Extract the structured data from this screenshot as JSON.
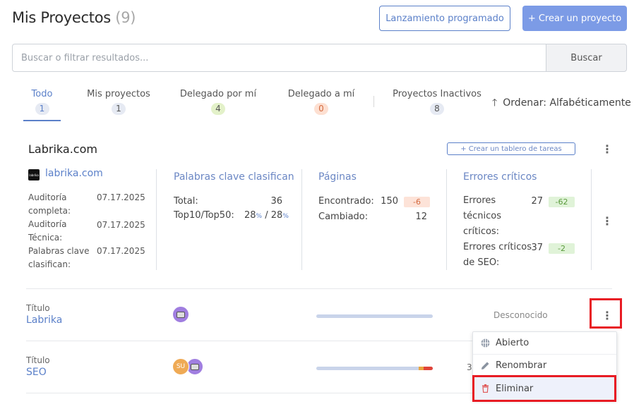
{
  "header": {
    "title": "Mis Proyectos",
    "count": "(9)",
    "scheduled_button": "Lanzamiento programado",
    "create_button": "+ Crear un proyecto"
  },
  "search": {
    "placeholder": "Buscar o filtrar resultados...",
    "button": "Buscar"
  },
  "tabs": [
    {
      "label": "Todo",
      "count": "1",
      "badge_color": "#e6eaf3"
    },
    {
      "label": "Mis proyectos",
      "count": "1",
      "badge_color": "#e6eaf3"
    },
    {
      "label": "Delegado por mí",
      "count": "4",
      "badge_color": "#e3f1c9"
    },
    {
      "label": "Delegado a mí",
      "count": "0",
      "badge_color": "#fde0d2"
    },
    {
      "label": "Proyectos Inactivos",
      "count": "8",
      "badge_color": "#e6eaf3"
    }
  ],
  "sort": {
    "label": "Ordenar: Alfabéticamente",
    "icon": "arrow-up-icon"
  },
  "project": {
    "name": "Labrika.com",
    "create_board": "+ Crear un tablero de tareas",
    "site": "labrika.com",
    "logo_text": "labrika",
    "audits": [
      {
        "label": "Auditoría completa:",
        "date": "07.17.2025"
      },
      {
        "label": "Auditoría Técnica:",
        "date": "07.17.2025"
      },
      {
        "label": "Palabras clave clasifican:",
        "date": "07.17.2025"
      }
    ],
    "keywords": {
      "title": "Palabras clave clasifican",
      "total_label": "Total:",
      "total_value": "36",
      "top_label": "Top10/Top50:",
      "top10": "28",
      "top50": "28",
      "pct": "%",
      "slash": " / "
    },
    "pages": {
      "title": "Páginas",
      "found_label": "Encontrado:",
      "found_value": "150",
      "found_delta": "-6",
      "changed_label": "Cambiado:",
      "changed_value": "12"
    },
    "errors": {
      "title": "Errores críticos",
      "tech_label": "Errores técnicos críticos:",
      "tech_value": "27",
      "tech_delta": "-62",
      "seo_label": "Errores críticos de SEO:",
      "seo_value": "37",
      "seo_delta": "-2"
    }
  },
  "rows": [
    {
      "caption": "Título",
      "title": "Labrika",
      "status": "Desconocido",
      "avatars": [
        "avatar-purple"
      ]
    },
    {
      "caption": "Título",
      "title": "SEO",
      "partial": "3",
      "avatar_initials": "SU",
      "orange_fraction": 0.04,
      "red_fraction": 0.08
    }
  ],
  "context_menu": {
    "items": [
      {
        "label": "Abierto",
        "icon": "grid-icon"
      },
      {
        "label": "Renombrar",
        "icon": "pencil-icon"
      },
      {
        "label": "Eliminar",
        "icon": "trash-icon"
      }
    ]
  },
  "colors": {
    "accent": "#5b80c9",
    "primary_button": "#7c9be6",
    "highlight": "#e81c24"
  }
}
